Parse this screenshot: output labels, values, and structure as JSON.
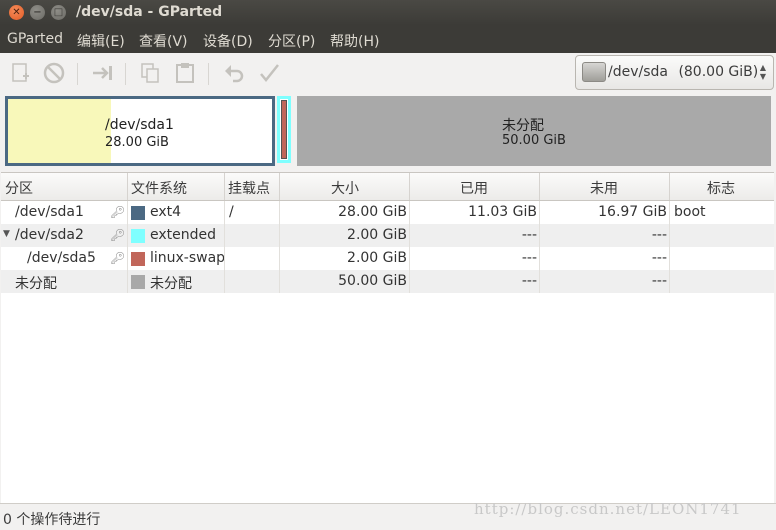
{
  "window": {
    "title": "/dev/sda - GParted"
  },
  "menu": [
    "GParted",
    "编辑(E)",
    "查看(V)",
    "设备(D)",
    "分区(P)",
    "帮助(H)"
  ],
  "device_selector": {
    "label": "/dev/sda",
    "size": "(80.00 GiB)"
  },
  "disk_map": {
    "sda1": {
      "name": "/dev/sda1",
      "size": "28.00 GiB",
      "used_fraction": 0.39
    },
    "unallocated": {
      "name": "未分配",
      "size": "50.00 GiB"
    }
  },
  "table": {
    "headers": [
      "分区",
      "文件系统",
      "挂载点",
      "大小",
      "已用",
      "未用",
      "标志"
    ],
    "rows": [
      {
        "partition": "/dev/sda1",
        "filesystem": "ext4",
        "fs_color": "#4b6983",
        "mount": "/",
        "size": "28.00 GiB",
        "used": "11.03 GiB",
        "unused": "16.97 GiB",
        "flags": "boot"
      },
      {
        "partition": "/dev/sda2",
        "filesystem": "extended",
        "fs_color": "#7fffff",
        "mount": "",
        "size": "2.00 GiB",
        "used": "---",
        "unused": "---",
        "flags": ""
      },
      {
        "partition": "/dev/sda5",
        "filesystem": "linux-swap",
        "fs_color": "#c1665a",
        "mount": "",
        "size": "2.00 GiB",
        "used": "---",
        "unused": "---",
        "flags": ""
      },
      {
        "partition": "未分配",
        "filesystem": "未分配",
        "fs_color": "#a9a9a9",
        "mount": "",
        "size": "50.00 GiB",
        "used": "---",
        "unused": "---",
        "flags": ""
      }
    ]
  },
  "status": {
    "text": "0 个操作待进行"
  },
  "watermark": "http://blog.csdn.net/LEON1741"
}
